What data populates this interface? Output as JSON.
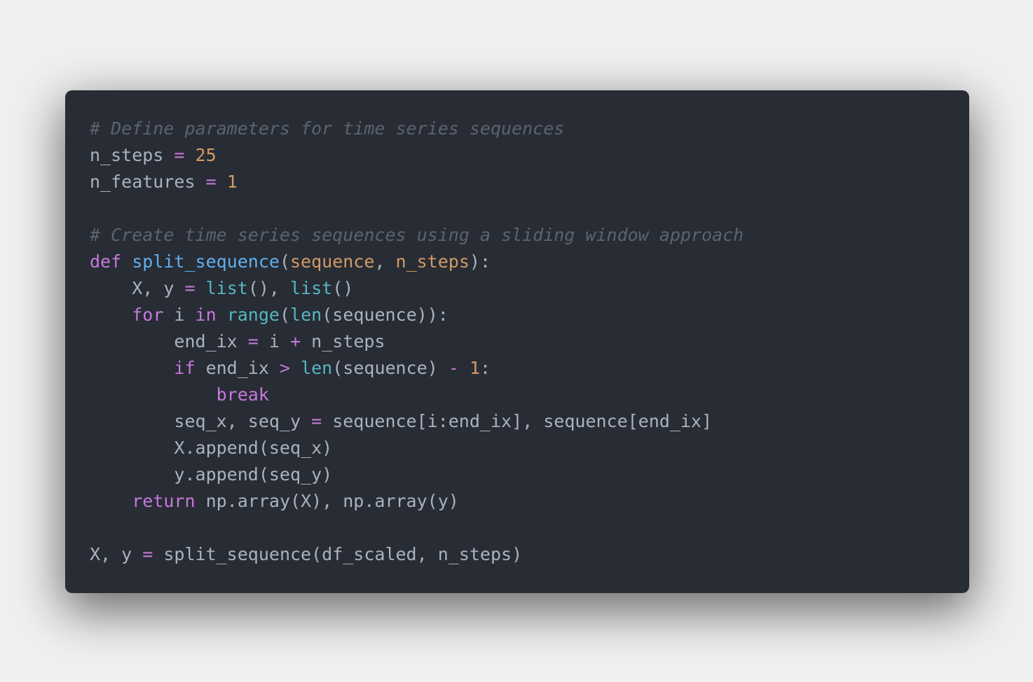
{
  "colors": {
    "background": "#f0f0f0",
    "editor_background": "#282c34",
    "comment": "#5c6370",
    "keyword": "#c678dd",
    "number": "#d19a66",
    "function": "#61afef",
    "builtin": "#56b6c2",
    "text": "#abb2bf"
  },
  "code_lines": [
    [
      {
        "t": "comment",
        "v": "# Define parameters for time series sequences"
      }
    ],
    [
      {
        "t": "text",
        "v": "n_steps "
      },
      {
        "t": "operator",
        "v": "="
      },
      {
        "t": "text",
        "v": " "
      },
      {
        "t": "number",
        "v": "25"
      }
    ],
    [
      {
        "t": "text",
        "v": "n_features "
      },
      {
        "t": "operator",
        "v": "="
      },
      {
        "t": "text",
        "v": " "
      },
      {
        "t": "number",
        "v": "1"
      }
    ],
    [],
    [
      {
        "t": "comment",
        "v": "# Create time series sequences using a sliding window approach"
      }
    ],
    [
      {
        "t": "keyword",
        "v": "def"
      },
      {
        "t": "text",
        "v": " "
      },
      {
        "t": "function",
        "v": "split_sequence"
      },
      {
        "t": "text",
        "v": "("
      },
      {
        "t": "param",
        "v": "sequence"
      },
      {
        "t": "text",
        "v": ", "
      },
      {
        "t": "param",
        "v": "n_steps"
      },
      {
        "t": "text",
        "v": "):"
      }
    ],
    [
      {
        "t": "text",
        "v": "    X, y "
      },
      {
        "t": "operator",
        "v": "="
      },
      {
        "t": "text",
        "v": " "
      },
      {
        "t": "builtin",
        "v": "list"
      },
      {
        "t": "text",
        "v": "(), "
      },
      {
        "t": "builtin",
        "v": "list"
      },
      {
        "t": "text",
        "v": "()"
      }
    ],
    [
      {
        "t": "text",
        "v": "    "
      },
      {
        "t": "keyword",
        "v": "for"
      },
      {
        "t": "text",
        "v": " i "
      },
      {
        "t": "keyword",
        "v": "in"
      },
      {
        "t": "text",
        "v": " "
      },
      {
        "t": "builtin",
        "v": "range"
      },
      {
        "t": "text",
        "v": "("
      },
      {
        "t": "builtin",
        "v": "len"
      },
      {
        "t": "text",
        "v": "(sequence)):"
      }
    ],
    [
      {
        "t": "text",
        "v": "        end_ix "
      },
      {
        "t": "operator",
        "v": "="
      },
      {
        "t": "text",
        "v": " i "
      },
      {
        "t": "operator",
        "v": "+"
      },
      {
        "t": "text",
        "v": " n_steps"
      }
    ],
    [
      {
        "t": "text",
        "v": "        "
      },
      {
        "t": "keyword",
        "v": "if"
      },
      {
        "t": "text",
        "v": " end_ix "
      },
      {
        "t": "operator",
        "v": ">"
      },
      {
        "t": "text",
        "v": " "
      },
      {
        "t": "builtin",
        "v": "len"
      },
      {
        "t": "text",
        "v": "(sequence) "
      },
      {
        "t": "operator",
        "v": "-"
      },
      {
        "t": "text",
        "v": " "
      },
      {
        "t": "number",
        "v": "1"
      },
      {
        "t": "text",
        "v": ":"
      }
    ],
    [
      {
        "t": "text",
        "v": "            "
      },
      {
        "t": "keyword",
        "v": "break"
      }
    ],
    [
      {
        "t": "text",
        "v": "        seq_x, seq_y "
      },
      {
        "t": "operator",
        "v": "="
      },
      {
        "t": "text",
        "v": " sequence[i:end_ix], sequence[end_ix]"
      }
    ],
    [
      {
        "t": "text",
        "v": "        X.append(seq_x)"
      }
    ],
    [
      {
        "t": "text",
        "v": "        y.append(seq_y)"
      }
    ],
    [
      {
        "t": "text",
        "v": "    "
      },
      {
        "t": "keyword",
        "v": "return"
      },
      {
        "t": "text",
        "v": " np.array(X), np.array(y)"
      }
    ],
    [],
    [
      {
        "t": "text",
        "v": "X, y "
      },
      {
        "t": "operator",
        "v": "="
      },
      {
        "t": "text",
        "v": " split_sequence(df_scaled, n_steps)"
      }
    ]
  ]
}
